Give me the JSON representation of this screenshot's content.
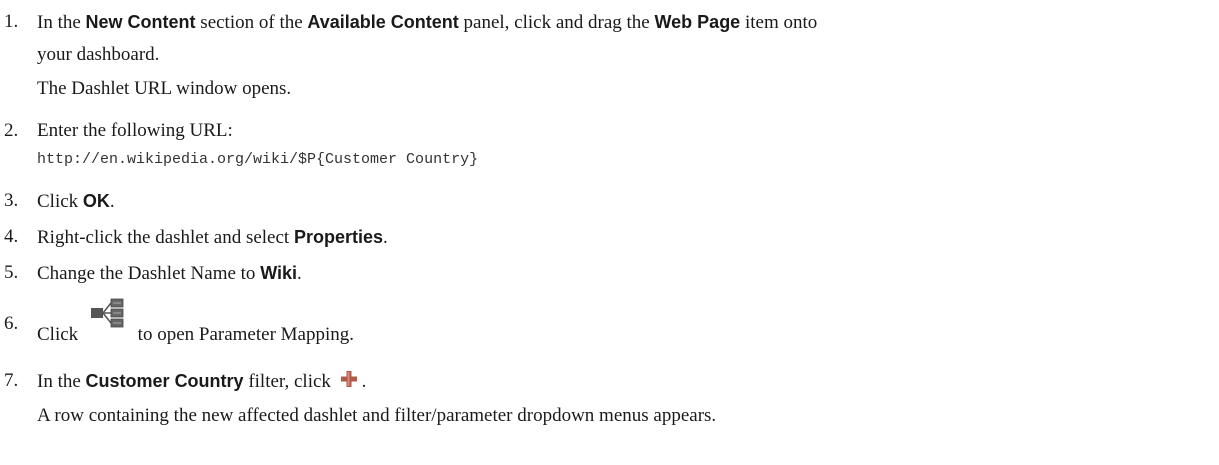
{
  "steps": [
    {
      "number": "1.",
      "pre": "In the ",
      "b1": "New Content",
      "mid1": " section of the ",
      "b2": "Available Content",
      "mid2": " panel, click and drag the ",
      "b3": "Web Page",
      "post": " item onto",
      "wrap": "your dashboard.",
      "result": "The Dashlet URL window opens."
    },
    {
      "number": "2.",
      "text": "Enter the following URL:",
      "code": "http://en.wikipedia.org/wiki/$P{Customer Country}"
    },
    {
      "number": "3.",
      "pre": "Click ",
      "b1": "OK",
      "post": "."
    },
    {
      "number": "4.",
      "pre": "Right-click the dashlet and select ",
      "b1": "Properties",
      "post": "."
    },
    {
      "number": "5.",
      "pre": "Change the Dashlet Name to ",
      "b1": "Wiki",
      "post": "."
    },
    {
      "number": "6.",
      "pre": "Click ",
      "icon": "parameter-mapping-icon",
      "post": " to open Parameter Mapping."
    },
    {
      "number": "7.",
      "pre": "In the ",
      "b1": "Customer Country",
      "mid1": " filter, click ",
      "icon": "add-plus-icon",
      "post": ".",
      "result": "A row containing the new affected dashlet and filter/parameter dropdown menus appears."
    }
  ]
}
